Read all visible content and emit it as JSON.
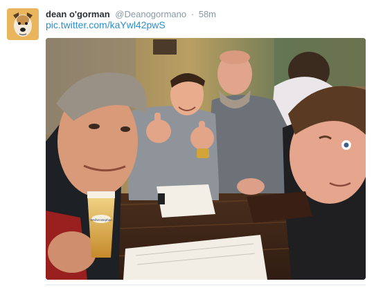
{
  "tweet": {
    "display_name": "dean o'gorman",
    "handle": "@Deanogormano",
    "separator": "·",
    "timestamp": "58m",
    "link_text": "pic.twitter.com/kaYwl42pwS",
    "avatar_icon": "dog-avatar-icon",
    "photo_label": "Weihenstephan",
    "colors": {
      "name": "#292f33",
      "meta": "#8899a6",
      "link": "#2a8ed1"
    }
  }
}
